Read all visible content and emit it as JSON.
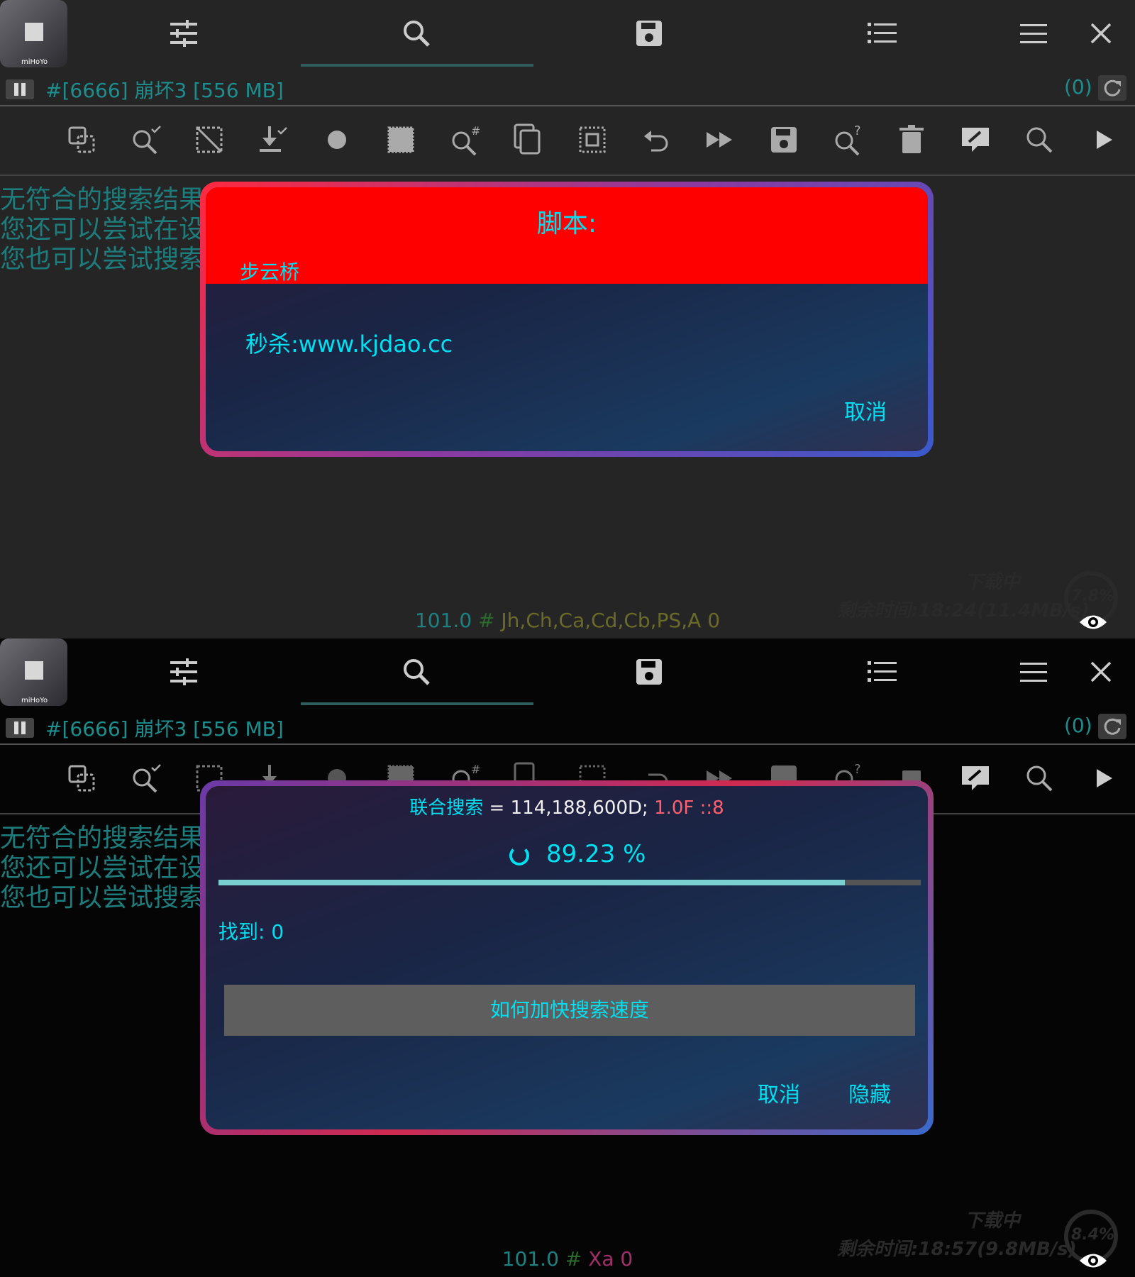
{
  "app_tile": {
    "label": "miHoYo"
  },
  "process": {
    "title": "#[6666] 崩坏3 [556 MB]",
    "count": "(0)"
  },
  "message_lines": [
    "无符合的搜索结果。请尝试重新搜索。",
    "您还可以尝试在设置选项卡中选择更多值域。",
    "您也可以尝试搜索未知值。"
  ],
  "panel1": {
    "footer": {
      "num": "101.0",
      "hash": "#",
      "types": "Jh,Ch,Ca,Cd,Cb,PS,A 0"
    },
    "download": {
      "title": "下载中",
      "time": "剩余时间:18:24(11.4MB/s)",
      "percent": "7.8%"
    }
  },
  "panel2": {
    "footer": {
      "num": "101.0",
      "hash": "#",
      "types": "Xa 0"
    },
    "download": {
      "title": "下载中",
      "time": "剩余时间:18:57(9.8MB/s)",
      "percent": "8.4%"
    }
  },
  "script_dialog": {
    "title": "脚本:",
    "subtitle": "步云桥",
    "body": "秒杀:www.kjdao.cc",
    "cancel": "取消"
  },
  "search_dialog": {
    "label": "联合搜索",
    "query": " = 114,188,600D;",
    "query_pink": " 1.0F ::8",
    "percent_text": "89.23 %",
    "progress": 0.8923,
    "found": "找到: 0",
    "help_button": "如何加快搜索速度",
    "cancel": "取消",
    "hide": "隐藏"
  },
  "colors": {
    "accent": "#00e0f0",
    "teal_text": "#1e8d8d",
    "dialog_header": "#ff0000"
  }
}
